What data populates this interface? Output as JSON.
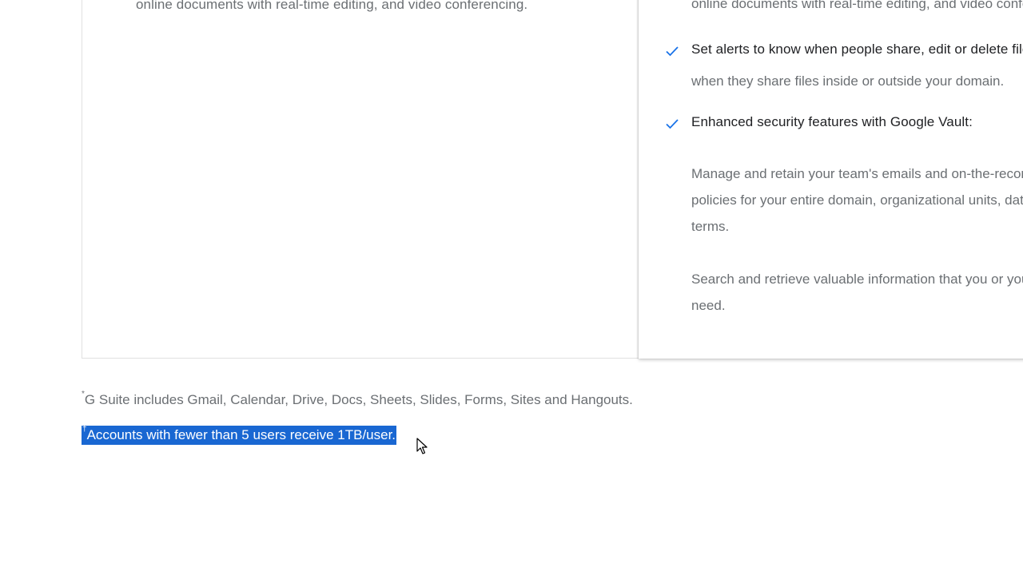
{
  "plans": {
    "left": {
      "description": "online documents with real-time editing, and video conferencing."
    },
    "right": {
      "description": "online documents with real-time editing, and video conferencing.",
      "features": [
        {
          "icon": "check-icon",
          "title": "Set alerts to know when people share, edit or delete files",
          "body": "when they share files inside or outside your domain."
        },
        {
          "icon": "check-icon",
          "title": "Enhanced security features with Google Vault:",
          "body": ""
        }
      ],
      "paragraphs": [
        {
          "line1": "Manage and retain your team's emails and on-the-record chats with retention",
          "line2": "policies for your entire domain, organizational units, date ranges, and search",
          "line3": "terms."
        },
        {
          "line1": "Search and retrieve valuable information that you or your team might",
          "line2": "need."
        }
      ]
    }
  },
  "footnotes": [
    {
      "mark": "*",
      "text": "G Suite includes Gmail, Calendar, Drive, Docs, Sheets, Slides, Forms, Sites and Hangouts."
    },
    {
      "mark": "†",
      "text": "Accounts with fewer than 5 users receive 1TB/user."
    }
  ],
  "colors": {
    "accent": "#1a73e8",
    "selection": "#1967d2",
    "title_text": "#202124",
    "body_text": "#6b6f73"
  }
}
